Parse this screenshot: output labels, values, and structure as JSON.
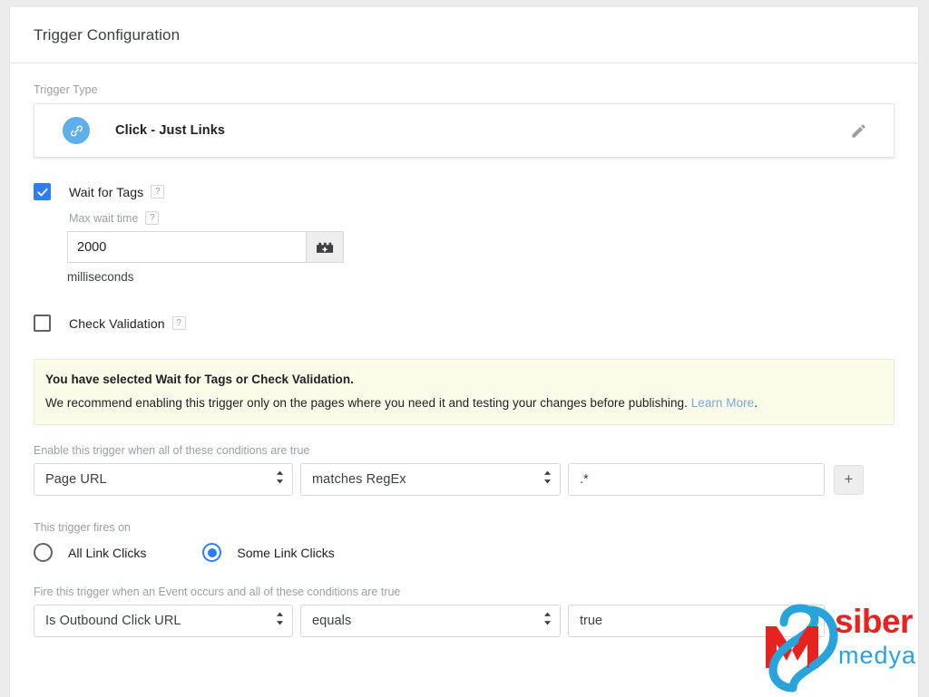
{
  "header": {
    "title": "Trigger Configuration"
  },
  "trigger_type": {
    "label": "Trigger Type",
    "name": "Click - Just Links",
    "icon": "link-icon",
    "edit_icon": "pencil-icon",
    "icon_color": "#5eb0ea"
  },
  "wait_for_tags": {
    "label": "Wait for Tags",
    "checked": true,
    "help": "?",
    "max_wait_label": "Max wait time",
    "max_wait_help": "?",
    "value": "2000",
    "unit": "milliseconds",
    "variable_button_icon": "variable-block-icon"
  },
  "check_validation": {
    "label": "Check Validation",
    "checked": false,
    "help": "?"
  },
  "notice": {
    "title": "You have selected Wait for Tags or Check Validation.",
    "text": "We recommend enabling this trigger only on the pages where you need it and testing your changes before publishing.",
    "link": "Learn More",
    "link_suffix": ".",
    "bg_color": "#fbfbea",
    "link_color": "#7ba7d7"
  },
  "enable_conditions": {
    "caption": "Enable this trigger when all of these conditions are true",
    "variable": "Page URL",
    "operator": "matches RegEx",
    "value": ".*",
    "add_button": "+"
  },
  "fires_on": {
    "caption": "This trigger fires on",
    "options": [
      {
        "label": "All Link Clicks",
        "selected": false
      },
      {
        "label": "Some Link Clicks",
        "selected": true
      }
    ],
    "accent_color": "#2d7ff0"
  },
  "event_conditions": {
    "caption": "Fire this trigger when an Event occurs and all of these conditions are true",
    "variable": "Is Outbound Click URL",
    "operator": "equals",
    "value": "true"
  },
  "watermark": {
    "brand_primary": "siber",
    "brand_secondary": "medya",
    "red": "#e8221f",
    "blue": "#29a3dc"
  }
}
